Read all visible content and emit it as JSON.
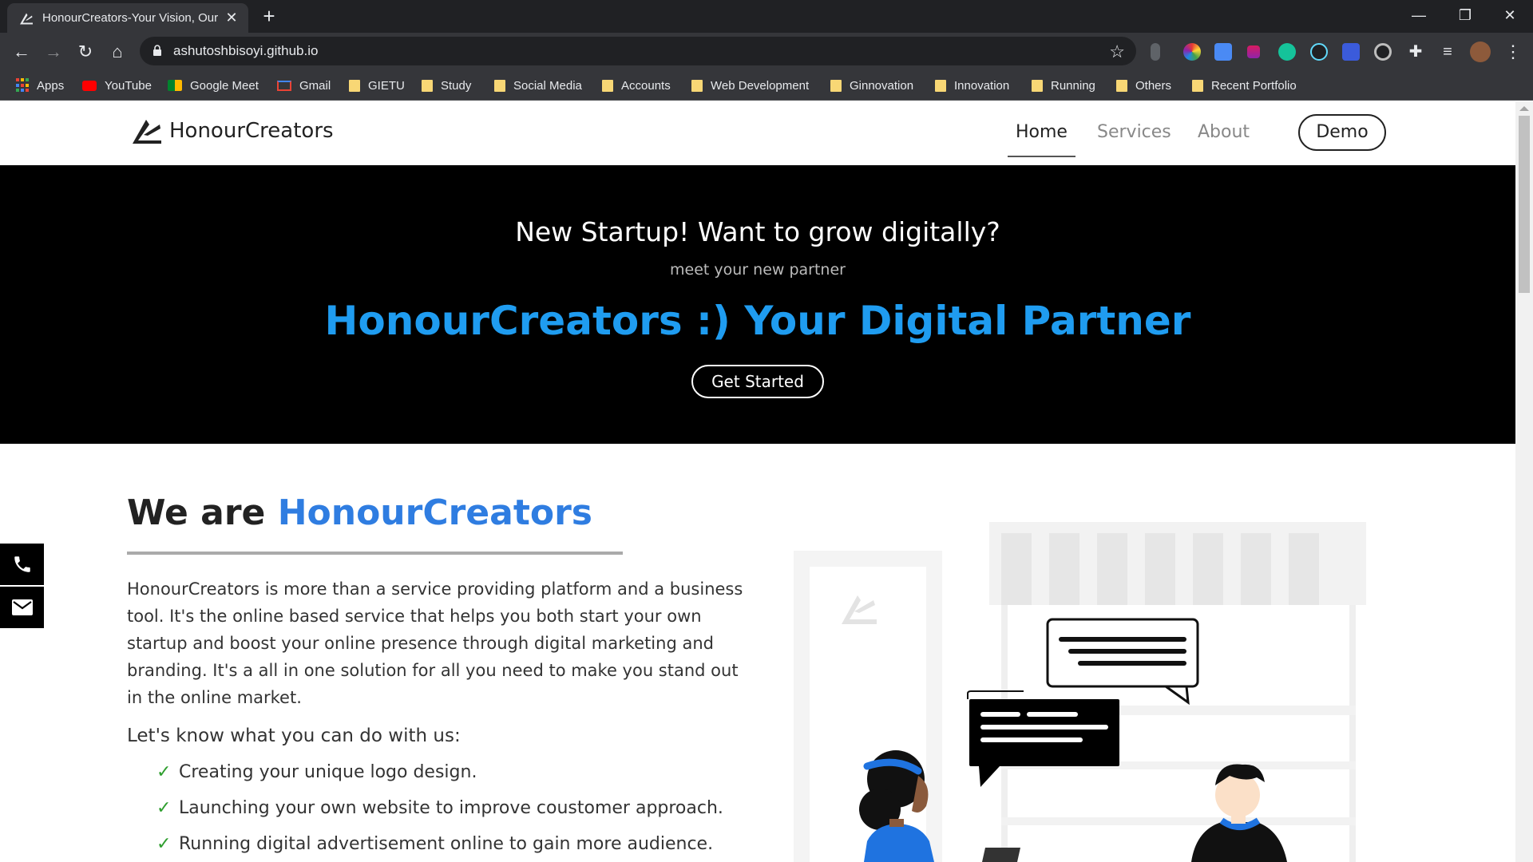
{
  "browser": {
    "tab_title": "HonourCreators-Your Vision, Our",
    "url": "ashutoshbisoyi.github.io",
    "bookmarks": [
      {
        "label": "Apps",
        "icon": "apps-grid-icon"
      },
      {
        "label": "YouTube",
        "icon": "youtube-icon"
      },
      {
        "label": "Google Meet",
        "icon": "google-meet-icon"
      },
      {
        "label": "Gmail",
        "icon": "gmail-icon"
      },
      {
        "label": "GIETU",
        "icon": "folder-icon"
      },
      {
        "label": "Study",
        "icon": "folder-icon"
      },
      {
        "label": "Social Media",
        "icon": "folder-icon"
      },
      {
        "label": "Accounts",
        "icon": "folder-icon"
      },
      {
        "label": "Web Development",
        "icon": "folder-icon"
      },
      {
        "label": "Ginnovation",
        "icon": "folder-icon"
      },
      {
        "label": "Innovation",
        "icon": "folder-icon"
      },
      {
        "label": "Running",
        "icon": "folder-icon"
      },
      {
        "label": "Others",
        "icon": "folder-icon"
      },
      {
        "label": "Recent Portfolio",
        "icon": "folder-icon"
      }
    ]
  },
  "nav": {
    "brand": "HonourCreators",
    "links": [
      "Home",
      "Services",
      "About"
    ],
    "active": "Home",
    "demo": "Demo"
  },
  "hero": {
    "question": "New Startup! Want to grow digitally?",
    "subtitle": "meet your new partner",
    "headline": "HonourCreators :) Your Digital Partner",
    "cta": "Get Started"
  },
  "about": {
    "title_prefix": "We are ",
    "title_brand": "HonourCreators",
    "description": "HonourCreators is more than a service providing platform and a business tool. It's the online based service that helps you both start your own startup and boost your online presence through digital marketing and branding. It's a all in one solution for all you need to make you stand out in the online market.",
    "know_heading": "Let's know what you can do with us:",
    "features": [
      "Creating your unique logo design.",
      "Launching your own website to improve coustomer approach.",
      "Running digital advertisement online to gain more audience."
    ]
  },
  "colors": {
    "brand_blue": "#2f7de1",
    "hero_blue": "#1f9cf0",
    "hero_bg": "#000000",
    "check_green": "#2e9e2e"
  }
}
